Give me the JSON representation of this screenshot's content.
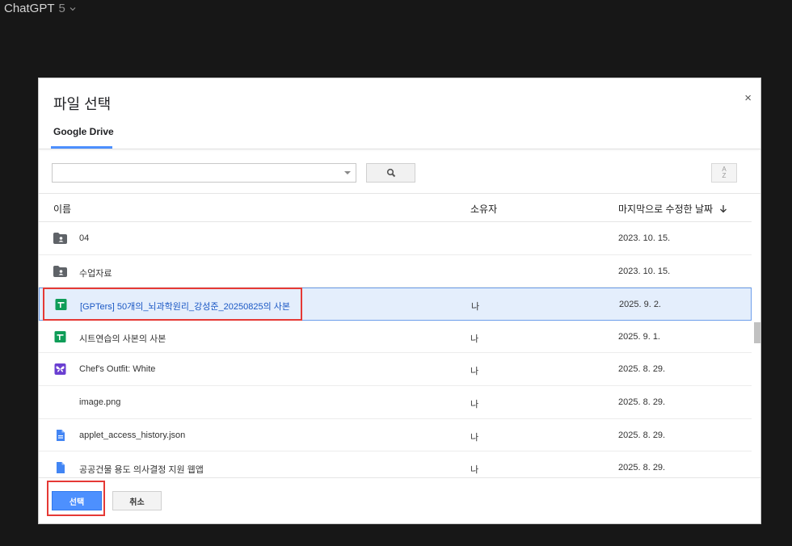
{
  "app": {
    "title": "ChatGPT",
    "version": "5"
  },
  "dialog": {
    "title": "파일 선택",
    "close": "×",
    "tab": "Google Drive",
    "search": {
      "value": "",
      "placeholder": ""
    },
    "columns": {
      "name": "이름",
      "owner": "소유자",
      "date": "마지막으로 수정한 날짜"
    },
    "rows": [
      {
        "name": "04",
        "owner": "",
        "date": "2023. 10. 15.",
        "icon": "shared-folder-icon"
      },
      {
        "name": "수업자료",
        "owner": "",
        "date": "2023. 10. 15.",
        "icon": "shared-folder-icon"
      },
      {
        "name": "[GPTers] 50개의_뇌과학원리_강성준_20250825의 사본",
        "owner": "나",
        "date": "2025. 9. 2.",
        "icon": "google-sheets-icon",
        "selected": true
      },
      {
        "name": "시트연습의 사본의 사본",
        "owner": "나",
        "date": "2025. 9. 1.",
        "icon": "google-sheets-icon"
      },
      {
        "name": "Chef's Outfit: White",
        "owner": "나",
        "date": "2025. 8. 29.",
        "icon": "butterfly-app-icon"
      },
      {
        "name": "image.png",
        "owner": "나",
        "date": "2025. 8. 29.",
        "icon": ""
      },
      {
        "name": "applet_access_history.json",
        "owner": "나",
        "date": "2025. 8. 29.",
        "icon": "doc-file-icon"
      },
      {
        "name": "공공건물 용도 의사결정 지원 웹앱",
        "owner": "나",
        "date": "2025. 8. 29.",
        "icon": "doc-file-icon"
      }
    ],
    "buttons": {
      "select": "선택",
      "cancel": "취소"
    }
  },
  "colors": {
    "accent": "#4d90fe",
    "highlight": "#e53935",
    "sheets": "#0f9d58",
    "app": "#6a3fd1",
    "doc": "#4285f4"
  }
}
